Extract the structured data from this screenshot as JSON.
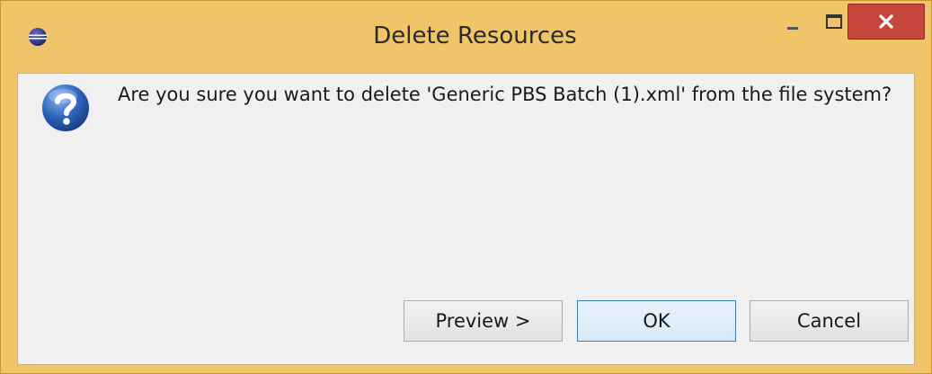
{
  "window": {
    "title": "Delete Resources"
  },
  "dialog": {
    "message": "Are you sure you want to delete 'Generic PBS Batch (1).xml' from the file system?",
    "icon": "question-icon"
  },
  "buttons": {
    "preview_label": "Preview >",
    "ok_label": "OK",
    "cancel_label": "Cancel"
  },
  "colors": {
    "frame": "#f0c56a",
    "close_button": "#c7463b",
    "client_background": "#f0f0f0",
    "default_button_border": "#3c7fb1"
  }
}
